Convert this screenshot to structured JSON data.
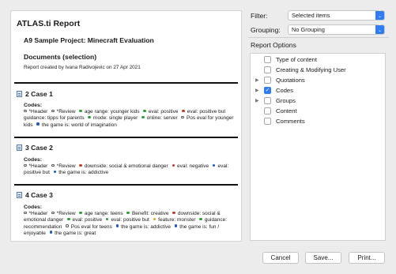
{
  "report": {
    "title": "ATLAS.ti Report",
    "project": "A9 Sample Project: Minecraft Evaluation",
    "section": "Documents (selection)",
    "created_by": "Report created by Ivana Radivojevic on 27 Apr 2021",
    "codes_label": "Codes:",
    "cases": [
      {
        "title": "2 Case 1",
        "codes": [
          {
            "text": "*Header",
            "color": "hollow"
          },
          {
            "text": "*Review",
            "color": "hollow"
          },
          {
            "text": "age range: younger kids",
            "color": "#2e9e3a"
          },
          {
            "text": "eval: positive",
            "color": "#2e9e3a"
          },
          {
            "text": "eval: positive but guidance: tipps for parents",
            "color": "#c23b2b"
          },
          {
            "text": "mode: single player",
            "color": "#2e9e3a"
          },
          {
            "text": "online: server",
            "color": "#2e9e3a"
          },
          {
            "text": "Pos eval for younger kids",
            "color": "hollow"
          },
          {
            "text": "the game is: world of imagination",
            "color": "#2457c8"
          }
        ]
      },
      {
        "title": "3 Case 2",
        "codes": [
          {
            "text": "*Header",
            "color": "hollow"
          },
          {
            "text": "*Review",
            "color": "hollow"
          },
          {
            "text": "downside: social & emotional danger",
            "color": "#c23b2b"
          },
          {
            "text": "eval: negative",
            "color": "#c23b2b"
          },
          {
            "text": "eval: positive but",
            "color": "#2457c8"
          },
          {
            "text": "the game is: addictive",
            "color": "#2457c8"
          }
        ]
      },
      {
        "title": "4 Case 3",
        "codes": [
          {
            "text": "*Header",
            "color": "hollow"
          },
          {
            "text": "*Review",
            "color": "hollow"
          },
          {
            "text": "age range: teens",
            "color": "#2e9e3a"
          },
          {
            "text": "Benefit: creative",
            "color": "#2e9e3a"
          },
          {
            "text": "downside: social & emotional danger",
            "color": "#c23b2b"
          },
          {
            "text": "eval: positive",
            "color": "#2e9e3a"
          },
          {
            "text": "eval: positive but",
            "color": "#2e9e3a"
          },
          {
            "text": "feature: monster",
            "color": "#e0a51c"
          },
          {
            "text": "guidance: recommendation",
            "color": "#2e9e3a"
          },
          {
            "text": "Pos eval for teens",
            "color": "hollow"
          },
          {
            "text": "the game is: addictive",
            "color": "#2457c8"
          },
          {
            "text": "the game is: fun / enjoyable",
            "color": "#2457c8"
          },
          {
            "text": "the game is: great",
            "color": "#2457c8"
          }
        ]
      }
    ]
  },
  "options": {
    "filter_label": "Filter:",
    "filter_value": "Selected items",
    "grouping_label": "Grouping:",
    "grouping_value": "No Grouping",
    "report_options_label": "Report Options",
    "items": [
      {
        "label": "Type of content",
        "checked": false,
        "expandable": false
      },
      {
        "label": "Creating & Modifying User",
        "checked": false,
        "expandable": false
      },
      {
        "label": "Quotations",
        "checked": false,
        "expandable": true
      },
      {
        "label": "Codes",
        "checked": true,
        "expandable": true
      },
      {
        "label": "Groups",
        "checked": false,
        "expandable": true
      },
      {
        "label": "Content",
        "checked": false,
        "expandable": false
      },
      {
        "label": "Comments",
        "checked": false,
        "expandable": false
      }
    ]
  },
  "buttons": {
    "cancel": "Cancel",
    "save": "Save...",
    "print": "Print..."
  },
  "icons": {
    "document": "document-icon",
    "popup_arrows": "chevron-updown-icon",
    "disclosure": "disclosure-triangle-icon",
    "checkmark": "checkmark-icon"
  }
}
